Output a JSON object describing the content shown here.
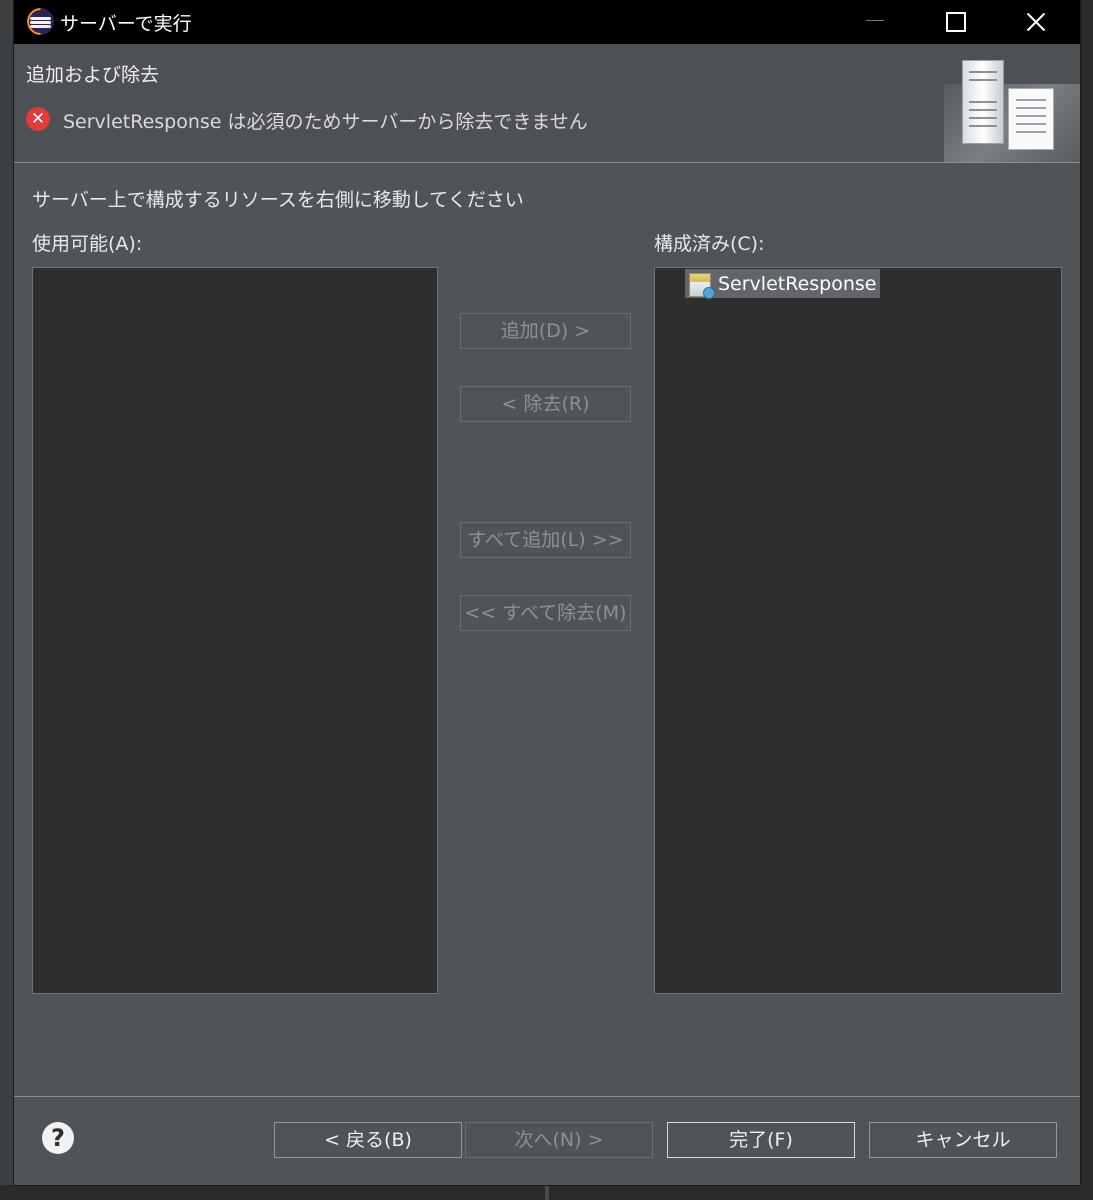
{
  "dialog": {
    "title": "サーバーで実行",
    "header_title": "追加および除去",
    "error_message": "ServletResponse は必須のためサーバーから除去できません",
    "instruction": "サーバー上で構成するリソースを右側に移動してください",
    "available_label": "使用可能(A):",
    "configured_label": "構成済み(C):",
    "available_items": [],
    "configured_items": [
      "ServletResponse"
    ]
  },
  "buttons": {
    "add": "追加(D) >",
    "remove": "< 除去(R)",
    "add_all": "すべて追加(L) >>",
    "remove_all": "<< すべて除去(M)",
    "back": "< 戻る(B)",
    "next": "次へ(N) >",
    "finish": "完了(F)",
    "cancel": "キャンセル"
  },
  "colors": {
    "dialog_bg": "#4f5458",
    "list_bg": "#2e2e2e",
    "titlebar_bg": "#000000",
    "error_red": "#e23b3b",
    "disabled_text": "#8d9196"
  },
  "icons": [
    "eclipse-app-icon",
    "error-icon",
    "server-banner-icon",
    "web-project-icon",
    "help-icon"
  ]
}
